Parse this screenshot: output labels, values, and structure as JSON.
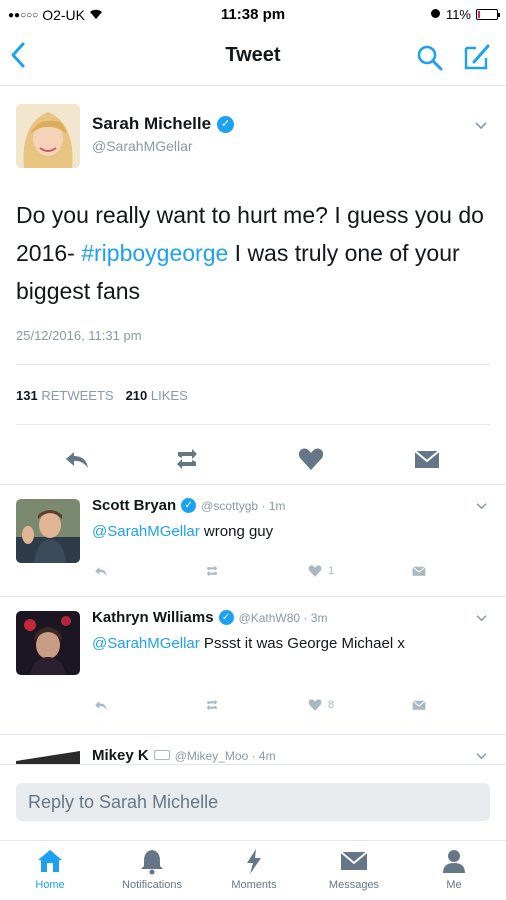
{
  "status_bar": {
    "carrier": "O2-UK",
    "time": "11:38 pm",
    "battery": "11%",
    "battery_level": 0.11
  },
  "nav": {
    "back_icon": "chevron-left-icon",
    "title": "Tweet",
    "search_icon": "search-icon",
    "compose_icon": "compose-icon",
    "accent": "#1da1f2"
  },
  "main_tweet": {
    "name": "Sarah Michelle",
    "handle": "@SarahMGellar",
    "text_before": "Do you really want to hurt me? I guess you do 2016- ",
    "hashtag": "#ripboygeorge",
    "text_after": " I was truly one of your biggest fans",
    "timestamp": "25/12/2016, 11:31 pm",
    "retweet_count": "131",
    "retweet_label": "RETWEETS",
    "like_count": "210",
    "like_label": "LIKES"
  },
  "replies": [
    {
      "name": "Scott Bryan",
      "handle": "@scottygb · 1m",
      "mention": "@SarahMGellar",
      "text": " wrong guy",
      "like_count": "1"
    },
    {
      "name": "Kathryn Williams",
      "handle": "@KathW80 · 3m",
      "mention": "@SarahMGellar",
      "text": " Pssst it was George Michael x",
      "like_count": "8"
    },
    {
      "name": "Mikey K",
      "handle": "@Mikey_Moo · 4m"
    }
  ],
  "composer": {
    "placeholder": "Reply to Sarah Michelle"
  },
  "tabs": [
    {
      "label": "Home",
      "icon": "home-icon",
      "active": true
    },
    {
      "label": "Notifications",
      "icon": "bell-icon",
      "active": false
    },
    {
      "label": "Moments",
      "icon": "lightning-icon",
      "active": false
    },
    {
      "label": "Messages",
      "icon": "envelope-icon",
      "active": false
    },
    {
      "label": "Me",
      "icon": "person-icon",
      "active": false
    }
  ]
}
